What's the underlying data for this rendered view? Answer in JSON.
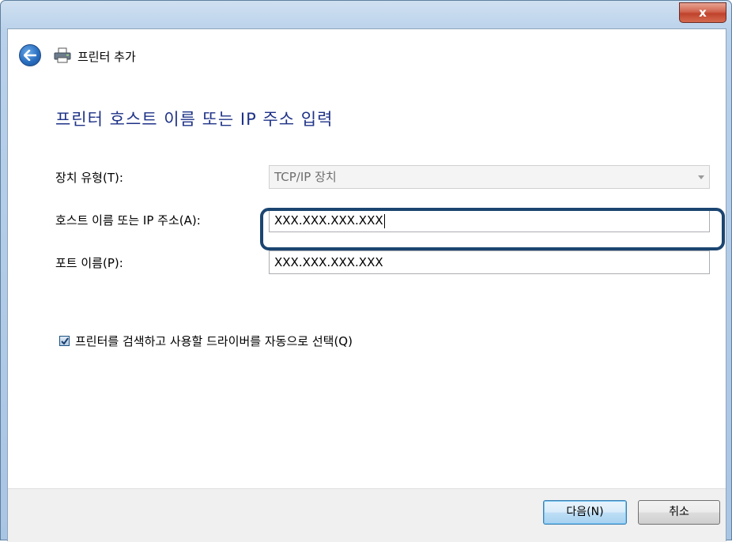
{
  "window": {
    "close_label": "x"
  },
  "header": {
    "title": "프린터 추가"
  },
  "main": {
    "heading": "프린터 호스트 이름 또는 IP 주소 입력",
    "device_type": {
      "label": "장치 유형(T):",
      "value": "TCP/IP 장치"
    },
    "hostname": {
      "label": "호스트 이름 또는 IP 주소(A):",
      "value": "XXX.XXX.XXX.XXX"
    },
    "port": {
      "label": "포트 이름(P):",
      "value": "XXX.XXX.XXX.XXX"
    },
    "auto_select": {
      "label": "프린터를 검색하고 사용할 드라이버를 자동으로 선택(Q)",
      "checked": true
    }
  },
  "footer": {
    "next_label": "다음(N)",
    "cancel_label": "취소"
  },
  "colors": {
    "heading": "#1e3287",
    "highlight": "#1b4571"
  }
}
